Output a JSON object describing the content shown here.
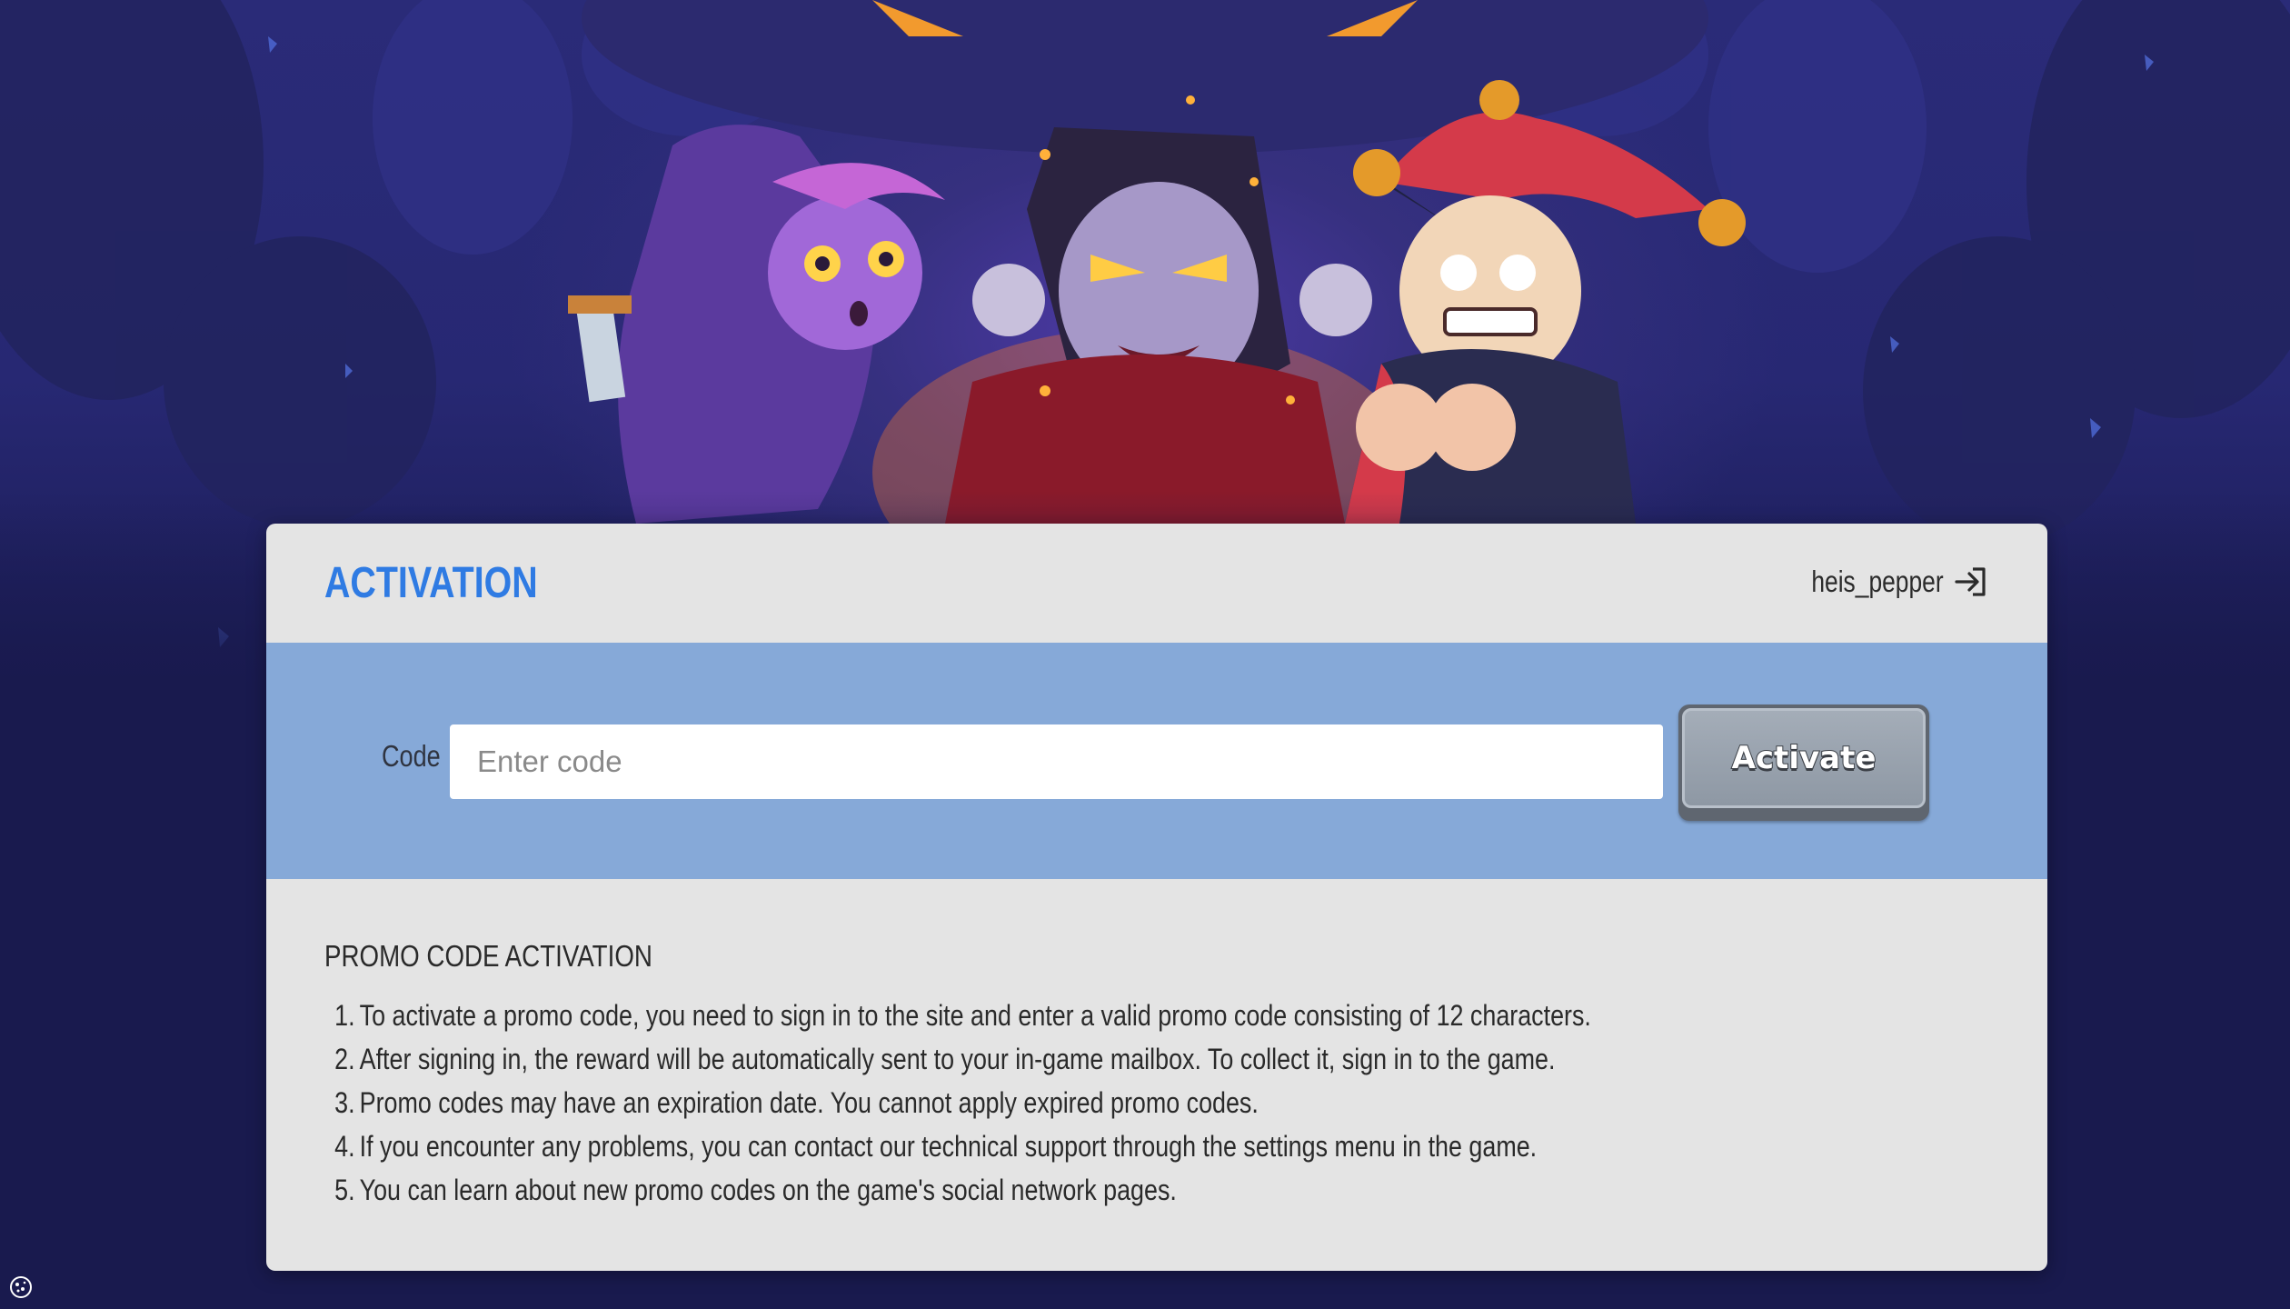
{
  "header": {
    "title": "ACTIVATION",
    "username": "heis_pepper",
    "logout_icon": "logout-arrow-icon"
  },
  "form": {
    "code_label": "Code",
    "code_placeholder": "Enter code",
    "code_value": "",
    "activate_label": "Activate"
  },
  "info": {
    "title": "PROMO CODE ACTIVATION",
    "items": [
      {
        "num": "1.",
        "text": "To activate a promo code, you need to sign in to the site and enter a valid promo code consisting of 12 characters."
      },
      {
        "num": "2.",
        "text": "After signing in, the reward will be automatically sent to your in-game mailbox. To collect it, sign in to the game."
      },
      {
        "num": "3.",
        "text": "Promo codes may have an expiration date. You cannot apply expired promo codes."
      },
      {
        "num": "4.",
        "text": "If you encounter any problems, you can contact our technical support through the settings menu in the game."
      },
      {
        "num": "5.",
        "text": "You can learn about new promo codes on the game's social network pages."
      }
    ]
  },
  "colors": {
    "accent": "#2f7be3",
    "band": "#86a9d8",
    "card": "#e4e4e4",
    "background": "#191a4e"
  },
  "icons": {
    "cookie": "cookie-icon"
  }
}
